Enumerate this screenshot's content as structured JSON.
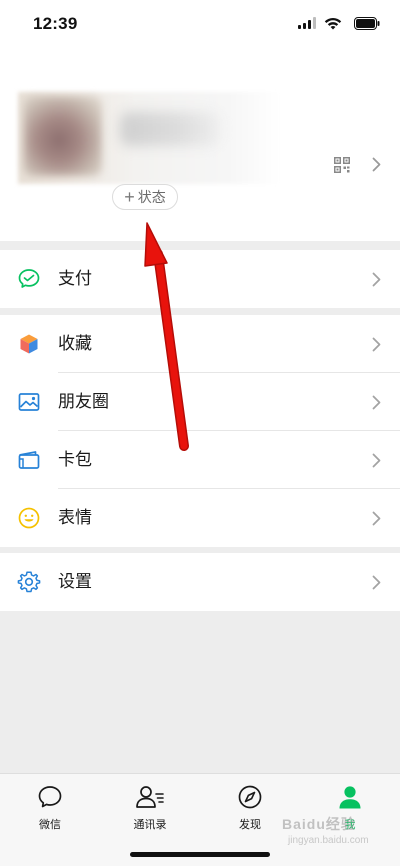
{
  "status_bar": {
    "time": "12:39",
    "icons": [
      "signal-icon",
      "wifi-icon",
      "battery-icon"
    ]
  },
  "profile": {
    "status_button_label": "状态",
    "status_button_icon": "plus-icon",
    "icons": [
      "qr-code-icon",
      "chevron-right-icon"
    ]
  },
  "sections": [
    {
      "items": [
        {
          "label": "支付",
          "icon": "payment-icon",
          "color": "#07c160"
        }
      ]
    },
    {
      "items": [
        {
          "label": "收藏",
          "icon": "favorites-cube-icon",
          "color": "#fa9d3b"
        },
        {
          "label": "朋友圈",
          "icon": "moments-image-icon",
          "color": "#2782d7"
        },
        {
          "label": "卡包",
          "icon": "card-wallet-icon",
          "color": "#2782d7"
        },
        {
          "label": "表情",
          "icon": "sticker-smile-icon",
          "color": "#f5c100"
        }
      ]
    },
    {
      "items": [
        {
          "label": "设置",
          "icon": "settings-gear-icon",
          "color": "#2782d7"
        }
      ]
    }
  ],
  "tabbar": {
    "tabs": [
      {
        "label": "微信",
        "icon": "chat-bubble-icon",
        "active": false
      },
      {
        "label": "通讯录",
        "icon": "contacts-icon",
        "active": false
      },
      {
        "label": "发现",
        "icon": "discover-compass-icon",
        "active": false
      },
      {
        "label": "我",
        "icon": "me-person-icon",
        "active": true
      }
    ],
    "active_color": "#07c160"
  },
  "watermark": {
    "text": "Baidu经验",
    "sub": "jingyan.baidu.com"
  },
  "annotation": {
    "type": "red-arrow",
    "color": "#e8130c"
  }
}
